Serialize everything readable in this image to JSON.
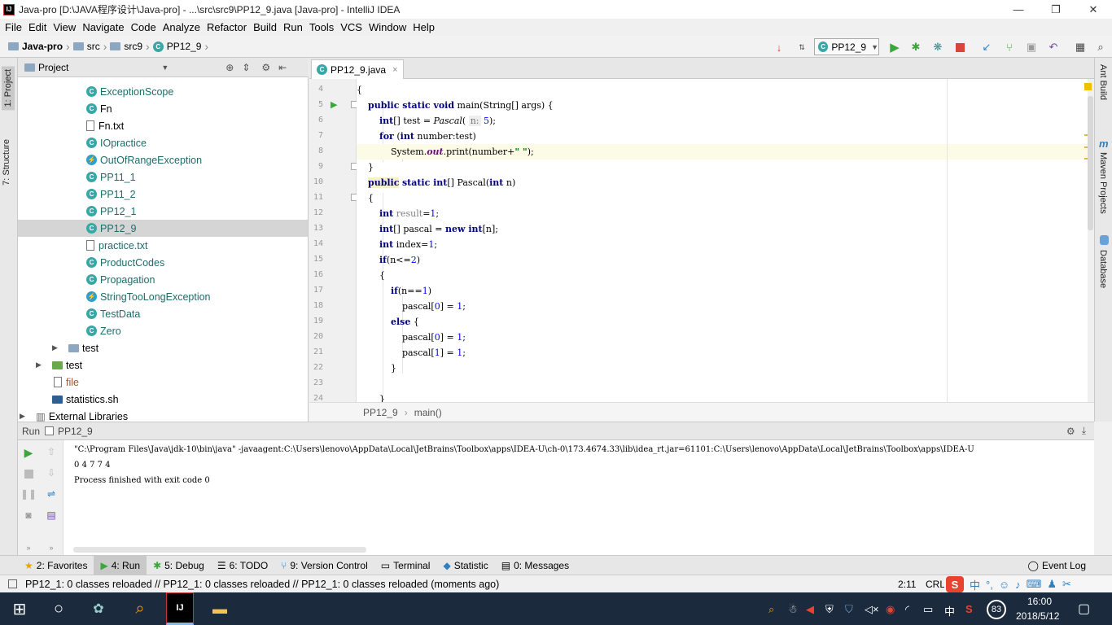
{
  "window": {
    "title": "Java-pro [D:\\JAVA程序设计\\Java-pro] - ...\\src\\src9\\PP12_9.java [Java-pro] - IntelliJ IDEA",
    "app_icon": "IJ",
    "controls": [
      "—",
      "❐",
      "✕"
    ]
  },
  "menu": [
    "File",
    "Edit",
    "View",
    "Navigate",
    "Code",
    "Analyze",
    "Refactor",
    "Build",
    "Run",
    "Tools",
    "VCS",
    "Window",
    "Help"
  ],
  "breadcrumb": [
    "Java-pro",
    "src",
    "src9",
    "PP12_9"
  ],
  "run_config": "PP12_9",
  "left_tabs": {
    "project": "1: Project",
    "structure": "7: Structure"
  },
  "right_tabs": {
    "ant": "Ant Build",
    "maven": "Maven Projects",
    "database": "Database"
  },
  "project_panel": {
    "title": "Project",
    "items": [
      {
        "label": "ExceptionScope",
        "type": "class"
      },
      {
        "label": "Fn",
        "type": "class"
      },
      {
        "label": "Fn.txt",
        "type": "text"
      },
      {
        "label": "IOpractice",
        "type": "class"
      },
      {
        "label": "OutOfRangeException",
        "type": "class"
      },
      {
        "label": "PP11_1",
        "type": "class"
      },
      {
        "label": "PP11_2",
        "type": "class"
      },
      {
        "label": "PP12_1",
        "type": "class"
      },
      {
        "label": "PP12_9",
        "type": "class"
      },
      {
        "label": "practice.txt",
        "type": "text"
      },
      {
        "label": "ProductCodes",
        "type": "class"
      },
      {
        "label": "Propagation",
        "type": "class"
      },
      {
        "label": "StringTooLongException",
        "type": "class"
      },
      {
        "label": "TestData",
        "type": "class"
      },
      {
        "label": "Zero",
        "type": "class"
      },
      {
        "label": "test",
        "type": "folder"
      },
      {
        "label": "test",
        "type": "folder-green"
      },
      {
        "label": "file",
        "type": "file"
      },
      {
        "label": "statistics.sh",
        "type": "script"
      },
      {
        "label": "External Libraries",
        "type": "lib"
      }
    ]
  },
  "editor": {
    "tab": "PP12_9.java",
    "line_numbers": [
      "4",
      "5",
      "6",
      "7",
      "8",
      "9",
      "10",
      "11",
      "12",
      "13",
      "14",
      "15",
      "16",
      "17",
      "18",
      "19",
      "20",
      "21",
      "22",
      "23",
      "24"
    ],
    "lines": [
      "{",
      "    public static void main(String[] args) {",
      "        int[] test = Pascal( n: 5);",
      "        for (int number:test)",
      "            System.out.print(number+\" \");",
      "    }",
      "    public static int[] Pascal(int n)",
      "    {",
      "        int result=1;",
      "        int[] pascal = new int[n];",
      "        int index=1;",
      "        if(n<=2)",
      "        {",
      "            if(n==1)",
      "                pascal[0] = 1;",
      "            else {",
      "                pascal[0] = 1;",
      "                pascal[1] = 1;",
      "            }",
      "",
      "        }"
    ],
    "hint_param": "n:",
    "breadcrumb": [
      "PP12_9",
      "main()"
    ]
  },
  "run_panel": {
    "title": "Run",
    "config": "PP12_9",
    "console": [
      "\"C:\\Program Files\\Java\\jdk-10\\bin\\java\" -javaagent:C:\\Users\\lenovo\\AppData\\Local\\JetBrains\\Toolbox\\apps\\IDEA-U\\ch-0\\173.4674.33\\lib\\idea_rt.jar=61101:C:\\Users\\lenovo\\AppData\\Local\\JetBrains\\Toolbox\\apps\\IDEA-U",
      "0 4 7 7 4",
      "Process finished with exit code 0"
    ]
  },
  "tool_windows": [
    {
      "label": "2: Favorites",
      "icon": "★"
    },
    {
      "label": "4: Run",
      "icon": "▶"
    },
    {
      "label": "5: Debug",
      "icon": "✱"
    },
    {
      "label": "6: TODO",
      "icon": "☰"
    },
    {
      "label": "9: Version Control",
      "icon": "⑂"
    },
    {
      "label": "Terminal",
      "icon": "▭"
    },
    {
      "label": "Statistic",
      "icon": "◆"
    },
    {
      "label": "0: Messages",
      "icon": "▤"
    }
  ],
  "event_log": "Event Log",
  "status": {
    "message": "PP12_1: 0 classes reloaded // PP12_1: 0 classes reloaded // PP12_1: 0 classes reloaded (moments ago)",
    "position": "2:11",
    "line_sep": "CRLF"
  },
  "taskbar": {
    "time": "16:00",
    "date": "2018/5/12",
    "ime": "中",
    "badge": "83",
    "start": "⊞",
    "search": "○"
  },
  "colors": {
    "accent": "#3aa7a7",
    "keyword": "#000080",
    "string": "#008000",
    "number": "#0000ff",
    "run_green": "#3ca63c",
    "stop_red": "#d9453d"
  }
}
